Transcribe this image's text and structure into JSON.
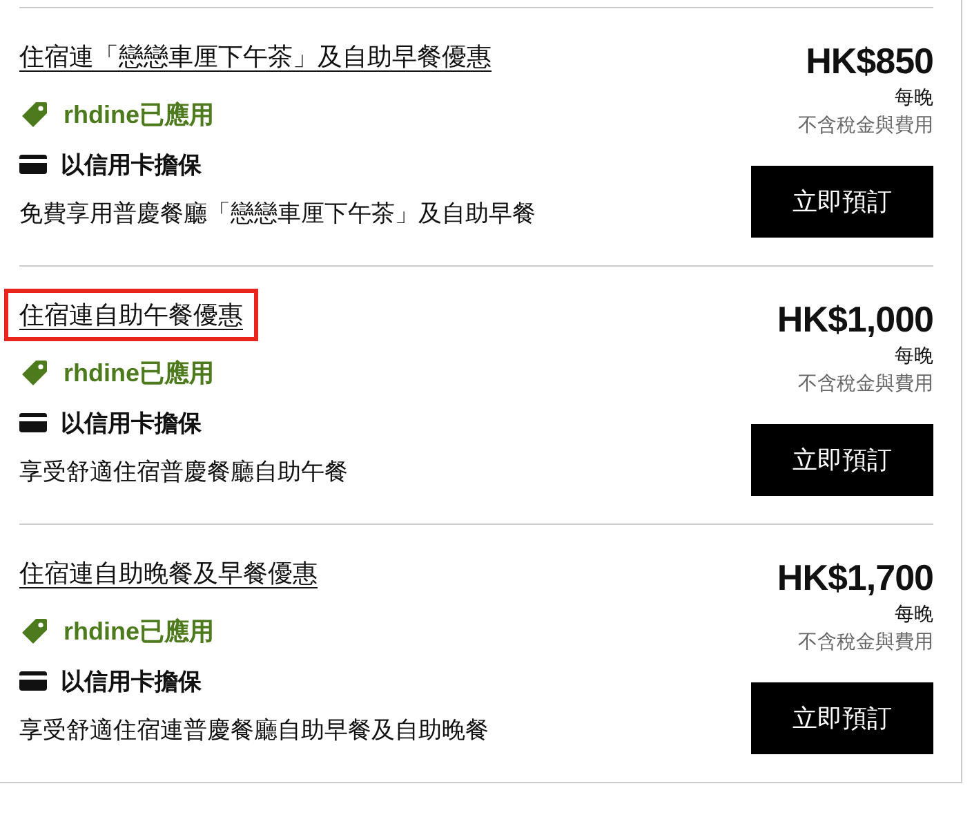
{
  "offers": [
    {
      "title": "住宿連「戀戀車厘下午茶」及自助早餐優惠",
      "highlighted": false,
      "promo": "rhdine已應用",
      "guarantee": "以信用卡擔保",
      "description": "免費享用普慶餐廳「戀戀車厘下午茶」及自助早餐",
      "price": "HK$850",
      "per": "每晚",
      "tax_note": "不含稅金與費用",
      "button": "立即預訂"
    },
    {
      "title": "住宿連自助午餐優惠",
      "highlighted": true,
      "promo": "rhdine已應用",
      "guarantee": "以信用卡擔保",
      "description": "享受舒適住宿普慶餐廳自助午餐",
      "price": "HK$1,000",
      "per": "每晚",
      "tax_note": "不含稅金與費用",
      "button": "立即預訂"
    },
    {
      "title": "住宿連自助晚餐及早餐優惠",
      "highlighted": false,
      "promo": "rhdine已應用",
      "guarantee": "以信用卡擔保",
      "description": "享受舒適住宿連普慶餐廳自助早餐及自助晚餐",
      "price": "HK$1,700",
      "per": "每晚",
      "tax_note": "不含稅金與費用",
      "button": "立即預訂"
    }
  ]
}
